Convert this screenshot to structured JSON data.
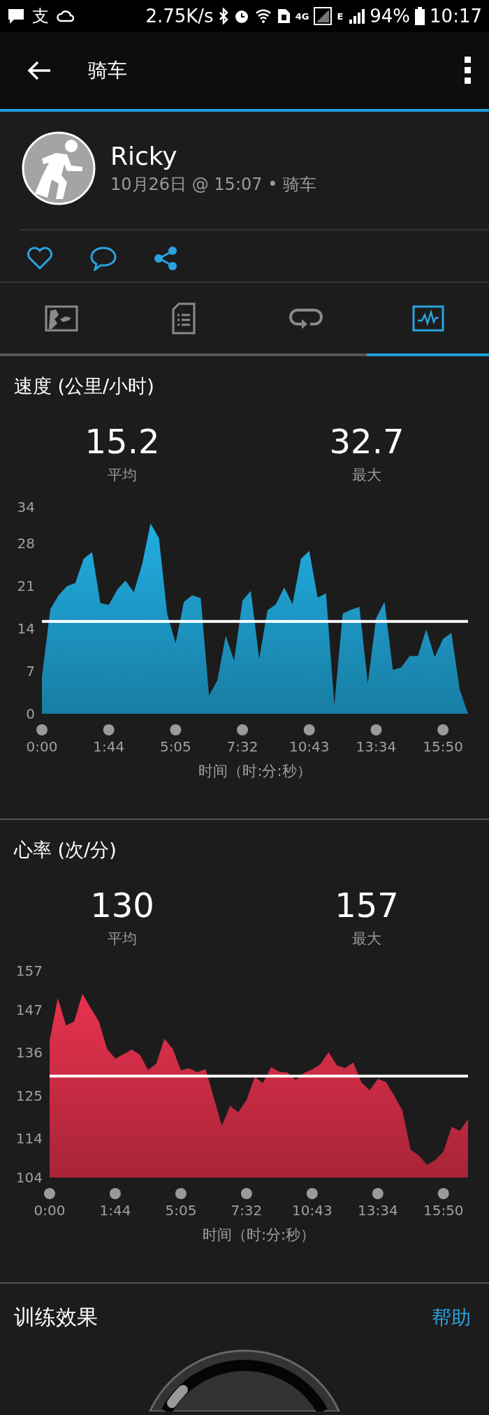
{
  "status_bar": {
    "notification_glyph": "支",
    "net_speed": "2.75K/s",
    "network_type": "4G",
    "data_mode": "E",
    "battery": "94%",
    "time": "10:17"
  },
  "app_bar": {
    "title": "骑车"
  },
  "activity": {
    "name": "Ricky",
    "meta": "10月26日 @ 15:07 • 骑车"
  },
  "tabs": [
    {
      "kind": "map",
      "selected": false
    },
    {
      "kind": "details",
      "selected": false
    },
    {
      "kind": "laps",
      "selected": false
    },
    {
      "kind": "charts",
      "selected": true
    }
  ],
  "sections": [
    {
      "title": "速度 (公里/小时)",
      "stats": [
        {
          "value": "15.2",
          "label": "平均"
        },
        {
          "value": "32.7",
          "label": "最大"
        }
      ],
      "chart_data": {
        "type": "area",
        "xlabel": "时间（时:分:秒）",
        "ylim": [
          0,
          34
        ],
        "yticks": [
          0,
          7,
          14,
          21,
          28,
          34
        ],
        "categories": [
          "0:00",
          null,
          null,
          null,
          null,
          null,
          null,
          null,
          "1:44",
          null,
          null,
          null,
          null,
          null,
          null,
          null,
          "5:05",
          null,
          null,
          null,
          null,
          null,
          null,
          null,
          "7:32",
          null,
          null,
          null,
          null,
          null,
          null,
          null,
          "10:43",
          null,
          null,
          null,
          null,
          null,
          null,
          null,
          "13:34",
          null,
          null,
          null,
          null,
          null,
          null,
          null,
          "15:50",
          null,
          null,
          null
        ],
        "series": [
          {
            "color": "#22aee2",
            "values": [
              6,
              17.2,
              19.5,
              21,
              21.5,
              25.5,
              26.6,
              18.2,
              17.9,
              20.4,
              21.9,
              20,
              24.6,
              31.3,
              28.9,
              16.4,
              11.6,
              18.4,
              19.5,
              19,
              3,
              5.5,
              12.8,
              8.7,
              18.6,
              20.2,
              9,
              17,
              18,
              20.8,
              18,
              25.5,
              26.8,
              19.1,
              19.8,
              1.4,
              16.5,
              17.1,
              17.6,
              5,
              15.7,
              18.4,
              7.2,
              7.6,
              9.5,
              9.5,
              13.9,
              9.3,
              12.3,
              13.3,
              4,
              0
            ]
          }
        ],
        "ref_lines": [
          {
            "axis": "y",
            "value": 15.2
          }
        ]
      }
    },
    {
      "title": "心率 (次/分)",
      "stats": [
        {
          "value": "130",
          "label": "平均"
        },
        {
          "value": "157",
          "label": "最大"
        }
      ],
      "chart_data": {
        "type": "area",
        "xlabel": "时间（时:分:秒）",
        "ylim": [
          104,
          157
        ],
        "yticks": [
          104,
          114,
          125,
          136,
          147,
          157
        ],
        "categories": [
          "0:00",
          null,
          null,
          null,
          null,
          null,
          null,
          null,
          "1:44",
          null,
          null,
          null,
          null,
          null,
          null,
          null,
          "5:05",
          null,
          null,
          null,
          null,
          null,
          null,
          null,
          "7:32",
          null,
          null,
          null,
          null,
          null,
          null,
          null,
          "10:43",
          null,
          null,
          null,
          null,
          null,
          null,
          null,
          "13:34",
          null,
          null,
          null,
          null,
          null,
          null,
          null,
          "15:50",
          null,
          null,
          null
        ],
        "series": [
          {
            "color": "#e8324e",
            "values": [
              139,
              150,
              143,
              144,
              151.1,
              147.5,
              144,
              137,
              134.5,
              135.6,
              136.8,
              135.5,
              131.6,
              133.2,
              139.6,
              137,
              131.5,
              132,
              131,
              131.8,
              124.6,
              117.2,
              122.4,
              120.7,
              123.9,
              129.8,
              128.2,
              132.3,
              131.1,
              130.9,
              129,
              130.8,
              131.7,
              133,
              136.2,
              132.8,
              132,
              133.5,
              128.4,
              126.4,
              129.3,
              128.5,
              125,
              121.2,
              111.1,
              109.7,
              107.2,
              108.5,
              110.6,
              117,
              116,
              119
            ]
          }
        ],
        "ref_lines": [
          {
            "axis": "y",
            "value": 130
          }
        ]
      }
    }
  ],
  "training": {
    "title": "训练效果",
    "help_link": "帮助"
  }
}
